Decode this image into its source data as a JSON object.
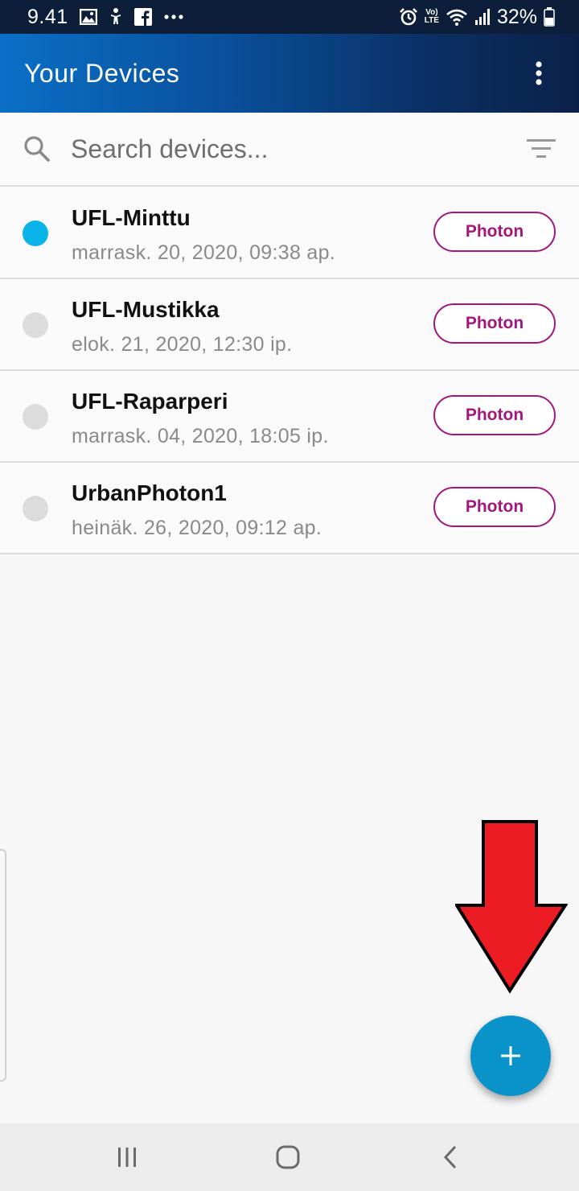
{
  "status_bar": {
    "time": "9.41",
    "battery": "32%",
    "left_icons": [
      "image-icon",
      "accessibility-icon",
      "facebook-icon",
      "more-notifications-icon"
    ],
    "right_icons": [
      "alarm-icon",
      "volte-icon",
      "wifi-icon",
      "signal-icon",
      "battery-icon"
    ],
    "volte_text": "Vo)",
    "lte_text": "LTE"
  },
  "app_bar": {
    "title": "Your Devices",
    "menu_icon": "more-vert-icon"
  },
  "search": {
    "placeholder": "Search devices...",
    "value": "",
    "search_icon": "search-icon",
    "filter_icon": "filter-icon"
  },
  "devices": [
    {
      "name": "UFL-Minttu",
      "last_seen": "marrask. 20, 2020, 09:38 ap.",
      "platform": "Photon",
      "online": true
    },
    {
      "name": "UFL-Mustikka",
      "last_seen": "elok. 21, 2020, 12:30 ip.",
      "platform": "Photon",
      "online": false
    },
    {
      "name": "UFL-Raparperi",
      "last_seen": "marrask. 04, 2020, 18:05 ip.",
      "platform": "Photon",
      "online": false
    },
    {
      "name": "UrbanPhoton1",
      "last_seen": "heinäk. 26, 2020, 09:12 ap.",
      "platform": "Photon",
      "online": false
    }
  ],
  "fab": {
    "icon": "add-icon"
  },
  "annotation": {
    "icon": "red-arrow-down-icon"
  },
  "nav_bar": {
    "icons": [
      "recent-apps-icon",
      "home-icon",
      "back-icon"
    ]
  },
  "colors": {
    "status_online": "#0ab3e8",
    "status_offline": "#dcdcdc",
    "badge": "#a3177d",
    "fab": "#0a93c9",
    "annotation_arrow": "#ec1c24"
  }
}
